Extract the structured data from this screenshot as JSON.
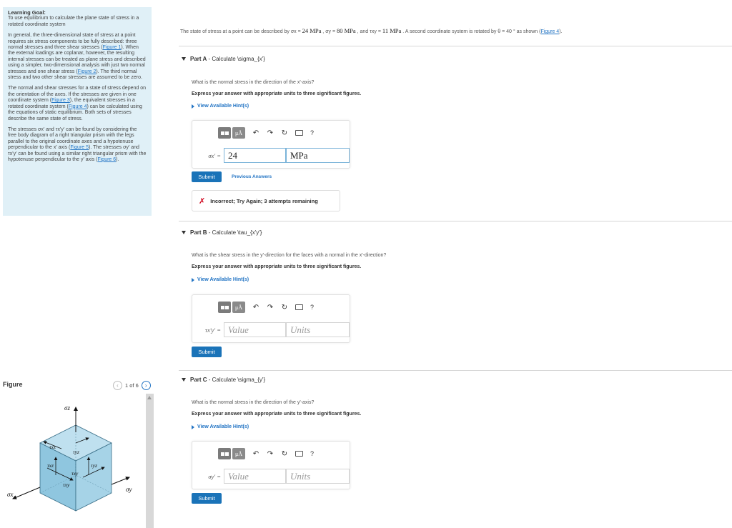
{
  "goal": {
    "heading": "Learning Goal:",
    "statement": "To use equilibrium to calculate the plane state of stress in a rotated coordinate system",
    "p1_text": "In general, the three-dimensional state of stress at a point requires six stress components to be fully described: three normal stresses and three shear stresses (",
    "p1_fig1": "Figure 1",
    "p1_text2": "). When the external loadings are coplanar, however, the resulting internal stresses can be treated as plane stress and described using a simpler, two-dimensional analysis with just two normal stresses and one shear stress (",
    "p1_fig2": "Figure 2",
    "p1_text3": "). The third normal stress and two other shear stresses are assumed to be zero.",
    "p2_text": "The normal and shear stresses for a state of stress depend on the orientation of the axes. If the stresses are given in one coordinate system (",
    "p2_fig3": "Figure 3",
    "p2_text2": "), the equivalent stresses in a rotated coordinate system (",
    "p2_fig4": "Figure 4",
    "p2_text3": ") can be calculated using the equations of static equilibrium. Both sets of stresses describe the same state of stress.",
    "p3_text": "The stresses σx' and τx'y' can be found by considering the free body diagram of a right triangular prism with the legs parallel to the original coordinate axes and a hypotenuse perpendicular to the x' axis (",
    "p3_fig5": "Figure 5",
    "p3_text2": "). The stresses σy' and τx'y' can be found using a similar right triangular prism with the hypotenuse perpendicular to the y' axis (",
    "p3_fig6": "Figure 6",
    "p3_text3": ")."
  },
  "figure": {
    "title": "Figure",
    "counter": "1 of 6",
    "prev_icon": "chevron-left-icon",
    "next_icon": "chevron-right-icon",
    "labels": {
      "sigma_z": "σz",
      "sigma_x": "σx",
      "sigma_y": "σy",
      "tau_xz": "τxz",
      "tau_yz_top": "τyz",
      "tau_xz_front": "τxz",
      "tau_xy_front": "τxy",
      "tau_yz_right": "τyz",
      "tau_xy_bottom": "τxy"
    }
  },
  "intro": {
    "text1": "The state of stress at a point can be described by σx = ",
    "sx": "24 MPa",
    "text2": " , σy = ",
    "sy": "80 MPa",
    "text3": " , and τxy = ",
    "txy": "11 MPa",
    "text4": " . A second coordinate system is rotated by θ = 40 ° as shown (",
    "fig_link": "Figure 4",
    "text5": ")."
  },
  "parts": [
    {
      "header_label": "Part A",
      "header_text": " - Calculate \\sigma_{x'}",
      "question": "What is the normal stress in the direction of the x'-axis?",
      "instruction": "Express your answer with appropriate units to three significant figures.",
      "hints": "View Available Hint(s)",
      "var_label": "σx' =",
      "value": "24",
      "value_placeholder": "",
      "unit": "MPa",
      "unit_placeholder": "",
      "submit": "Submit",
      "previous_answers": "Previous Answers",
      "feedback": "Incorrect; Try Again; 3 attempts remaining"
    },
    {
      "header_label": "Part B",
      "header_text": " - Calculate \\tau_{x'y'}",
      "question": "What is the shear stress in the y'-direction for the faces with a normal in the x'-direction?",
      "instruction": "Express your answer with appropriate units to three significant figures.",
      "hints": "View Available Hint(s)",
      "var_label": "τx'y' =",
      "value": "",
      "value_placeholder": "Value",
      "unit": "",
      "unit_placeholder": "Units",
      "submit": "Submit"
    },
    {
      "header_label": "Part C",
      "header_text": " - Calculate \\sigma_{y'}",
      "question": "What is the normal stress in the direction of the y'-axis?",
      "instruction": "Express your answer with appropriate units to three significant figures.",
      "hints": "View Available Hint(s)",
      "var_label": "σy' =",
      "value": "",
      "value_placeholder": "Value",
      "unit": "",
      "unit_placeholder": "Units",
      "submit": "Submit"
    }
  ],
  "toolbar": {
    "templates_icon": "templates-icon",
    "mu_label": "μÅ",
    "undo_icon": "undo-icon",
    "redo_icon": "redo-icon",
    "reset_icon": "reset-icon",
    "keyboard_icon": "keyboard-icon",
    "help_label": "?"
  },
  "colors": {
    "accent": "#1a73b8",
    "link": "#2274c4",
    "goal_bg": "#e0f0f7",
    "error": "#d0021b",
    "cube_face": "#9dcfe6"
  }
}
